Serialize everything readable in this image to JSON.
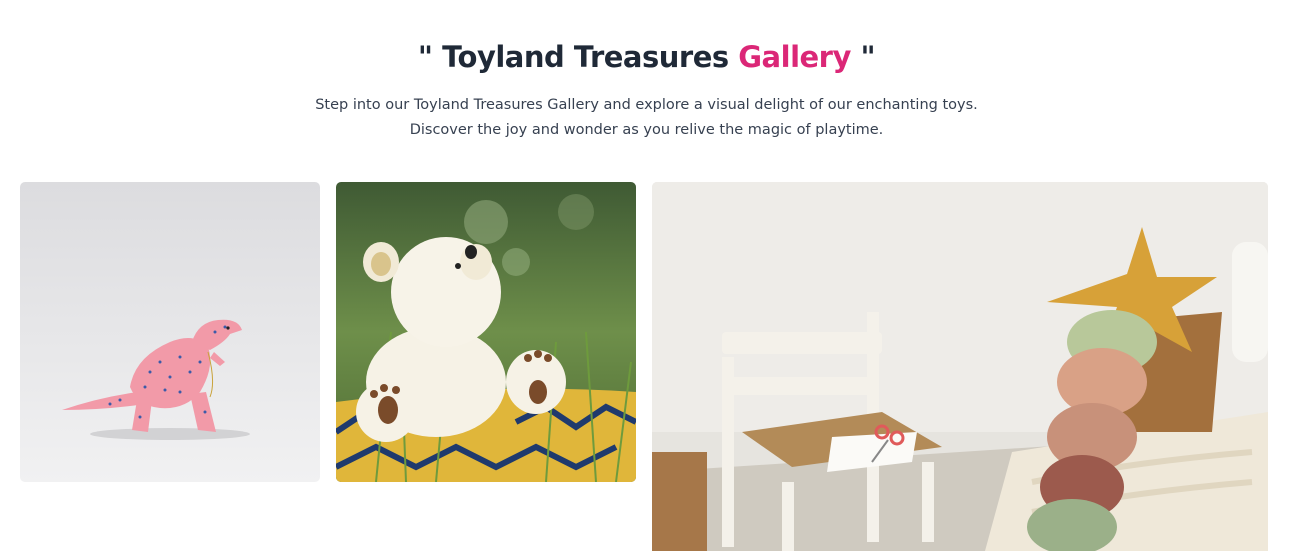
{
  "gallery": {
    "title_open_quote": "\"",
    "title_main": "Toyland Treasures",
    "title_accent": "Gallery",
    "title_close_quote": "\"",
    "subtitle_line1": "Step into our Toyland Treasures Gallery and explore a visual delight of our enchanting toys.",
    "subtitle_line2": "Discover the joy and wonder as you relive the magic of playtime.",
    "accent_color": "#db2777",
    "title_color": "#1f2937"
  }
}
